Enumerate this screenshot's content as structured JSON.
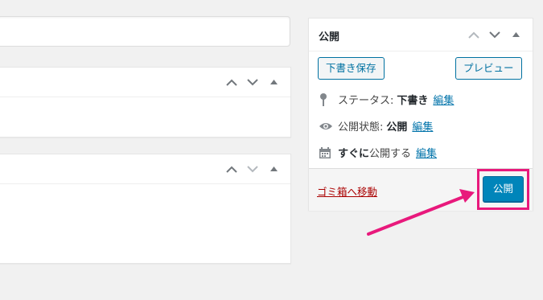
{
  "publish_box": {
    "title": "公開",
    "save_draft_label": "下書き保存",
    "preview_label": "プレビュー",
    "status": {
      "label": "ステータス:",
      "value": "下書き",
      "edit": "編集"
    },
    "visibility": {
      "label": "公開状態:",
      "value": "公開",
      "edit": "編集"
    },
    "schedule": {
      "prefix": "すぐに",
      "label": "公開する",
      "edit": "編集"
    },
    "trash_label": "ゴミ箱へ移動",
    "publish_label": "公開"
  },
  "colors": {
    "accent": "#0085ba",
    "link": "#0073aa",
    "trash": "#aa0000",
    "highlight": "#e8197c"
  },
  "icons": {
    "status": "pin-icon",
    "visibility": "eye-icon",
    "schedule": "calendar-icon",
    "move_up": "chevron-up-icon",
    "move_down": "chevron-down-icon",
    "toggle": "triangle-up-icon"
  }
}
